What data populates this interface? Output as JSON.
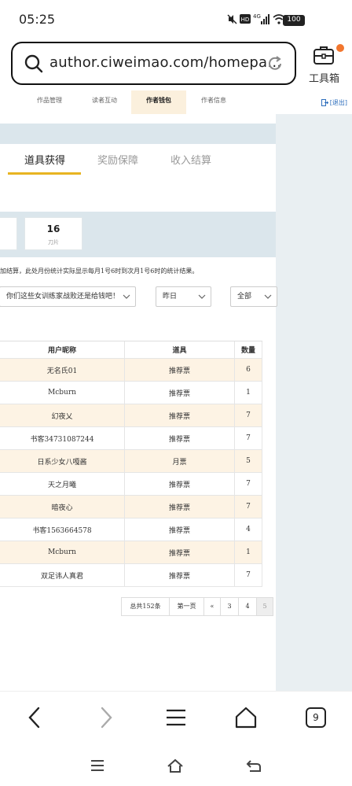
{
  "status": {
    "time": "05:25",
    "battery": "100"
  },
  "url_bar": {
    "url": "author.ciweimao.com/homepa…"
  },
  "toolbox": {
    "label": "工具箱"
  },
  "site_nav": {
    "items": [
      "作品管理",
      "读者互动",
      "作者钱包",
      "作者信息"
    ],
    "logout": "[退出]"
  },
  "tabs": [
    "道具获得",
    "奖励保障",
    "收入结算"
  ],
  "stats": {
    "value": "16",
    "label": "刀片"
  },
  "note": "加结算，此处月份统计实际显示每月1号6时到次月1号6时的统计结果。",
  "filters": {
    "select1": "你们这些女训练家战败还是给钱吧！",
    "select2": "昨日",
    "select3": "全部"
  },
  "table": {
    "headers": [
      "用户昵称",
      "道具",
      "数量"
    ],
    "rows": [
      [
        "无名氏01",
        "推荐票",
        "6"
      ],
      [
        "Mcburn",
        "推荐票",
        "1"
      ],
      [
        "幻夜乂",
        "推荐票",
        "7"
      ],
      [
        "书客34731087244",
        "推荐票",
        "7"
      ],
      [
        "日系少女八嘎酱",
        "月票",
        "5"
      ],
      [
        "天之月曦",
        "推荐票",
        "7"
      ],
      [
        "暗夜心",
        "推荐票",
        "7"
      ],
      [
        "书客1563664578",
        "推荐票",
        "4"
      ],
      [
        "Mcburn",
        "推荐票",
        "1"
      ],
      [
        "双足讳人真君",
        "推荐票",
        "7"
      ]
    ]
  },
  "pagination": {
    "total": "总共152条",
    "first": "第一页",
    "prev": "«",
    "pages": [
      "3",
      "4",
      "5"
    ]
  },
  "browser_nav": {
    "tab_count": "9"
  },
  "colors": {
    "accent_underline": "#e8b422",
    "active_nav_bg": "#fbf0dd",
    "row_highlight": "#fdf3e4",
    "panel_header": "#dbe6ec",
    "notification_dot": "#f2762e"
  }
}
